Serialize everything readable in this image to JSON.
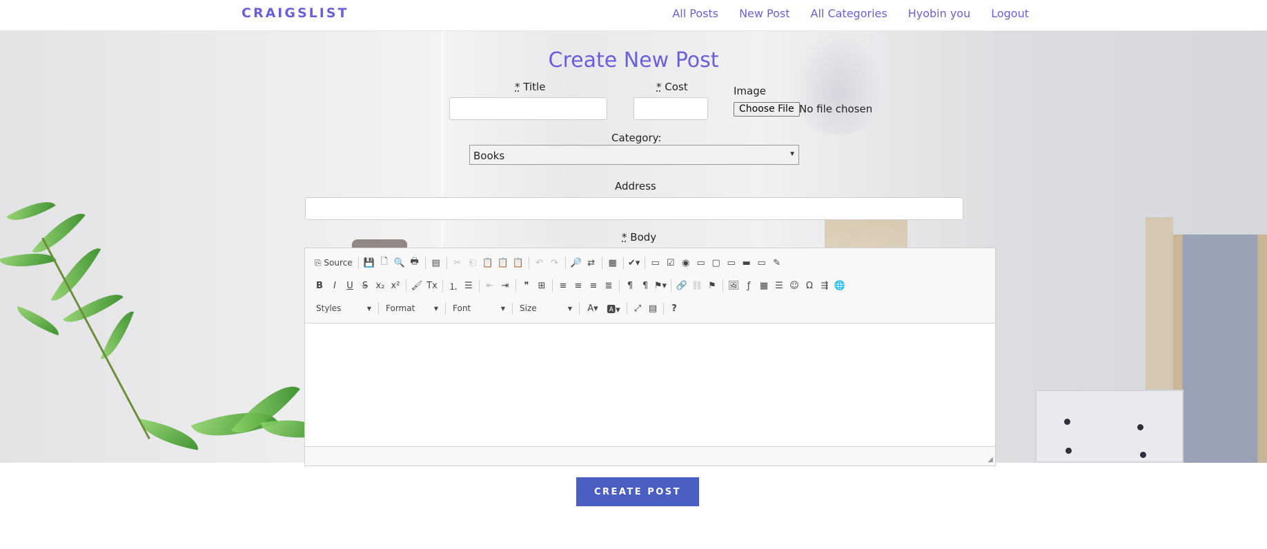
{
  "nav": {
    "brand": "CRAIGSLIST",
    "links": [
      "All Posts",
      "New Post",
      "All Categories",
      "Hyobin you",
      "Logout"
    ]
  },
  "form": {
    "title": "Create New Post",
    "required_mark": "*",
    "title_label": "Title",
    "cost_label": "Cost",
    "image_label": "Image",
    "file_button": "Choose File",
    "file_status": "No file chosen",
    "category_label": "Category:",
    "category_value": "Books",
    "address_label": "Address",
    "body_label": "Body",
    "submit_label": "CREATE POST"
  },
  "editor": {
    "source_label": "Source",
    "combos": [
      "Styles",
      "Format",
      "Font",
      "Size"
    ]
  },
  "colors": {
    "accent": "#6a5fd8",
    "button": "#4a5fc1"
  }
}
